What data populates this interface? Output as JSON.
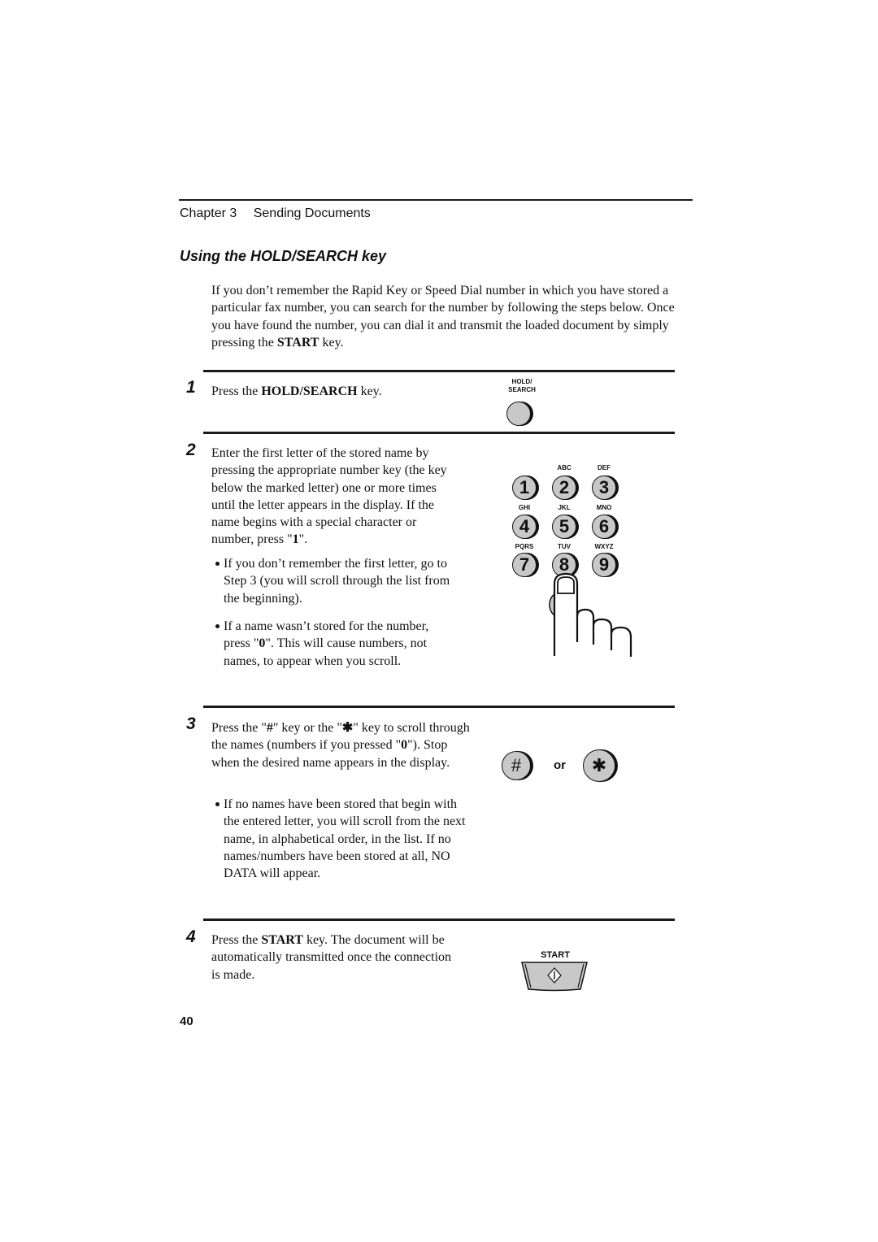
{
  "header": {
    "chapter_label": "Chapter 3",
    "chapter_title": "Sending Documents"
  },
  "section": {
    "title": "Using the HOLD/SEARCH key"
  },
  "intro": {
    "before_bold": "If you don’t remember the Rapid Key or Speed Dial number in which you have stored a particular fax number, you can search for the number by following the steps below. Once you have found the number, you can dial it and transmit the loaded document by simply pressing the ",
    "bold": "START",
    "after_bold": " key."
  },
  "steps": [
    {
      "number": "1",
      "text_before": "Press the ",
      "text_bold": "HOLD/SEARCH",
      "text_after": " key.",
      "illustration": {
        "key_label_line1": "HOLD/",
        "key_label_line2": "SEARCH",
        "icon": "round-key"
      }
    },
    {
      "number": "2",
      "text_before": "Enter the first letter of the stored name by pressing the appropriate number key (the key below the marked letter) one or more times until the letter appears in the display. If the name begins with a special character or number, press \"",
      "text_bold": "1",
      "text_after": "\".",
      "bullets": [
        {
          "text": "If you don’t remember the first letter, go to Step 3 (you will scroll through the list from the beginning)."
        },
        {
          "before_bold": "If a name wasn’t stored for the number, press \"",
          "bold": "0",
          "after_bold": "\". This will cause numbers, not names, to appear when you scroll."
        }
      ],
      "illustration": {
        "keypad": [
          {
            "digit": "1",
            "letters": ""
          },
          {
            "digit": "2",
            "letters": "ABC"
          },
          {
            "digit": "3",
            "letters": "DEF"
          },
          {
            "digit": "4",
            "letters": "GHI"
          },
          {
            "digit": "5",
            "letters": "JKL"
          },
          {
            "digit": "6",
            "letters": "MNO"
          },
          {
            "digit": "7",
            "letters": "PQRS"
          },
          {
            "digit": "8",
            "letters": "TUV"
          },
          {
            "digit": "9",
            "letters": "WXYZ"
          }
        ],
        "icon": "pointing-hand"
      }
    },
    {
      "number": "3",
      "text_before": "Press the \"",
      "text_bold_hash": "#",
      "text_mid": "\" key or the \"",
      "text_bold_star": "✱",
      "text_after": "\" key to scroll through the names (numbers if you pressed \"",
      "text_bold_zero": "0",
      "text_end": "\"). Stop when the desired name appears in the display.",
      "bullets": [
        {
          "text": "If no names have been stored that begin with the entered letter, you will scroll from the next name, in alphabetical order, in the list. If no names/numbers have been stored at all, NO DATA will appear."
        }
      ],
      "illustration": {
        "key_hash": "#",
        "or_label": "or",
        "key_star": "✱"
      }
    },
    {
      "number": "4",
      "text_before": "Press the ",
      "text_bold": "START",
      "text_after": " key. The document will be automatically transmitted once the connection is made.",
      "illustration": {
        "key_label": "START",
        "icon": "start-key"
      }
    }
  ],
  "footer": {
    "page_number": "40"
  }
}
